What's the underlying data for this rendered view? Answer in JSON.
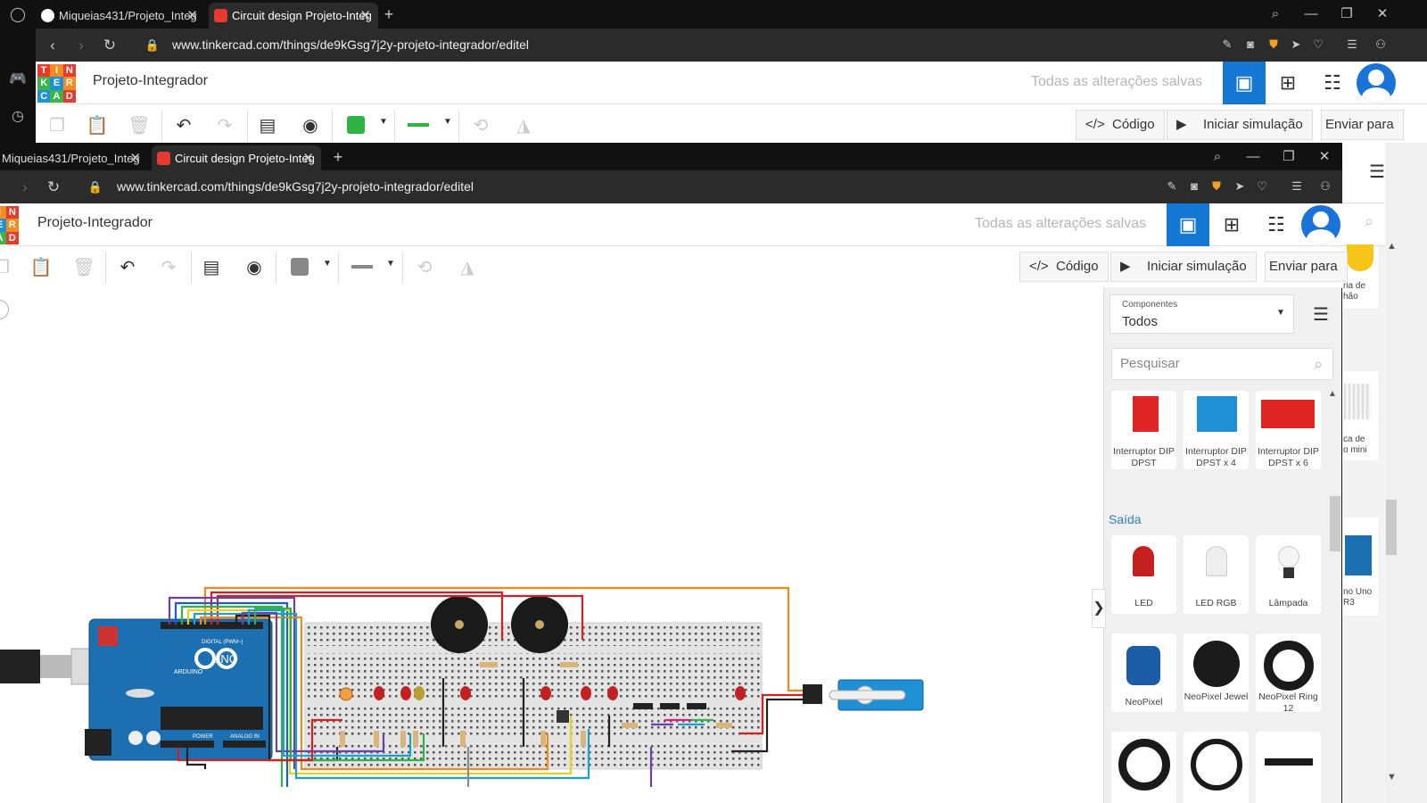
{
  "back_window": {
    "tabs": [
      {
        "label": "Miqueias431/Projeto_Integ"
      },
      {
        "label": "Circuit design Projeto-Integ"
      }
    ],
    "url": "www.tinkercad.com/things/de9kGsg7j2y-projeto-integrador/editel",
    "project_title": "Projeto-Integrador",
    "save_status": "Todas as alterações salvas",
    "toolbar": {
      "code_label": "Código",
      "sim_label": "Iniciar simulação",
      "send_label": "Enviar para"
    },
    "colors": {
      "fill": "#2fb344",
      "stroke": "#2fb344"
    }
  },
  "front_window": {
    "tabs": [
      {
        "label": "Miqueias431/Projeto_Integ"
      },
      {
        "label": "Circuit design Projeto-Integ"
      }
    ],
    "url": "www.tinkercad.com/things/de9kGsg7j2y-projeto-integrador/editel",
    "project_title": "Projeto-Integrador",
    "save_status": "Todas as alterações salvas",
    "toolbar": {
      "code_label": "Código",
      "sim_label": "Iniciar simulação",
      "send_label": "Enviar para"
    },
    "colors": {
      "fill": "#888888",
      "stroke": "#888888"
    }
  },
  "panel": {
    "dropdown_label": "Componentes",
    "dropdown_value": "Todos",
    "search_placeholder": "Pesquisar",
    "top_items": [
      {
        "label": "Interruptor DIP DPST"
      },
      {
        "label": "Interruptor DIP DPST x 4"
      },
      {
        "label": "Interruptor DIP DPST x 6"
      }
    ],
    "section_output": "Saída",
    "output_items": [
      {
        "label": "LED"
      },
      {
        "label": "LED RGB"
      },
      {
        "label": "Lâmpada"
      },
      {
        "label": "NeoPixel"
      },
      {
        "label": "NeoPixel Jewel"
      },
      {
        "label": "NeoPixel Ring 12"
      }
    ]
  },
  "bg_slice": {
    "labels": [
      "ria de\nhão",
      "ca de\no mini",
      "no Uno\nR3"
    ]
  },
  "canvas": {
    "board_label": "UNO",
    "brand": "ARDUINO",
    "digital_label": "DIGITAL (PWM~)",
    "power_label": "POWER",
    "analog_label": "ANALOG IN"
  },
  "brand_colors": {
    "tinkercad_blue": "#1477d4",
    "logo_red": "#e63a2e",
    "logo_orange": "#f58b1f",
    "logo_green": "#3bb54a",
    "logo_blue": "#1f8fd6"
  }
}
